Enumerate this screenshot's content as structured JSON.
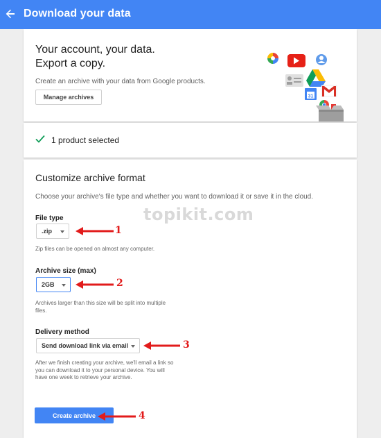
{
  "header": {
    "title": "Download your data"
  },
  "intro": {
    "headline_line1": "Your account, your data.",
    "headline_line2": "Export a copy.",
    "description": "Create an archive with your data from Google products.",
    "manage_button": "Manage archives"
  },
  "selection": {
    "status": "1 product selected"
  },
  "customize": {
    "title": "Customize archive format",
    "description": "Choose your archive's file type and whether you want to download it or save it in the cloud.",
    "file_type": {
      "label": "File type",
      "value": ".zip",
      "help": "Zip files can be opened on almost any computer."
    },
    "archive_size": {
      "label": "Archive size (max)",
      "value": "2GB",
      "help_line1": "Archives larger than this size will be split into multiple",
      "help_line2": "files."
    },
    "delivery": {
      "label": "Delivery method",
      "value": "Send download link via email",
      "help_line1": "After we finish creating your archive, we'll email a link so",
      "help_line2": "you can download it to your personal device. You will",
      "help_line3": "have one week to retrieve your archive."
    },
    "create_button": "Create archive"
  },
  "annotations": [
    "1",
    "2",
    "3",
    "4"
  ],
  "watermark": "topikit.com",
  "colors": {
    "header_bg": "#4285f4",
    "primary_button": "#4285f4",
    "check": "#0f9d58",
    "annotation_arrow": "#e21b1b"
  },
  "icons": [
    "back-arrow-icon",
    "check-icon",
    "photos-icon",
    "youtube-icon",
    "profile-icon",
    "contacts-icon",
    "drive-icon",
    "calendar-icon",
    "gmail-icon",
    "chrome-icon",
    "box-icon"
  ]
}
